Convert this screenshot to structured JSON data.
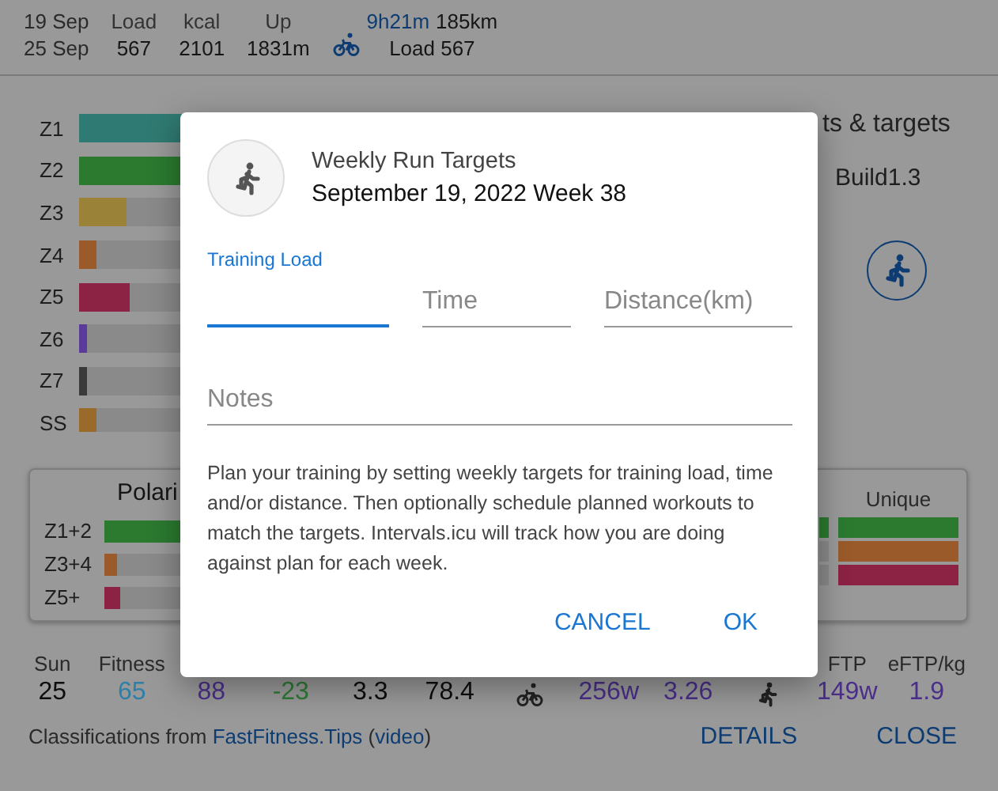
{
  "header": {
    "date_range": [
      "19 Sep",
      "25 Sep"
    ],
    "stats": [
      {
        "label": "Load",
        "value": "567"
      },
      {
        "label": "kcal",
        "value": "2101"
      },
      {
        "label": "Up",
        "value": "1831m"
      }
    ],
    "activity": {
      "kind": "bike",
      "time": "9h21m",
      "distance": "185km",
      "load": "Load 567"
    }
  },
  "zones": [
    {
      "label": "Z1",
      "level": 0.57,
      "color": "#2f7a72"
    },
    {
      "label": "Z2",
      "level": 0.5,
      "color": "#2b7a30"
    },
    {
      "label": "Z3",
      "level": 0.08,
      "color": "#9a8238"
    },
    {
      "label": "Z4",
      "level": 0.03,
      "color": "#9a5a2a"
    },
    {
      "label": "Z5",
      "level": 0.085,
      "color": "#8c2244"
    },
    {
      "label": "Z6",
      "level": 0.012,
      "color": "#5a3a9a"
    },
    {
      "label": "Z7",
      "level": 0.012,
      "color": "#3a3a3a"
    },
    {
      "label": "SS",
      "level": 0.03,
      "color": "#9a6a2a"
    }
  ],
  "side_panel": {
    "heading": "ts & targets",
    "plan": "Build1.3",
    "sport_button": {
      "kind": "run"
    }
  },
  "polarization": {
    "title": "Polari",
    "rows": [
      {
        "label": "Z1+2",
        "level": 0.6,
        "color": "#2b7a30"
      },
      {
        "label": "Z3+4",
        "level": 0.025,
        "color": "#9a5a2a"
      },
      {
        "label": "Z5+",
        "level": 0.03,
        "color": "#8c2244"
      }
    ],
    "columns": [
      {
        "bars": [
          {
            "filled": true,
            "color": "#2b7a30"
          },
          {
            "filled": false
          },
          {
            "filled": false
          }
        ]
      },
      {
        "title": "Unique",
        "bars": [
          {
            "level": 1,
            "color": "#2b7a30"
          },
          {
            "level": 1,
            "color": "#9a5a2a"
          },
          {
            "level": 1,
            "color": "#8c2244"
          }
        ]
      }
    ]
  },
  "stats": [
    {
      "kind": "stat",
      "label": "Sun",
      "value": "25"
    },
    {
      "kind": "stat",
      "label": "Fitness",
      "value": "65",
      "color": "#2d7fa8"
    },
    {
      "kind": "stat",
      "value": "88",
      "color": "#4a2e8a"
    },
    {
      "kind": "stat",
      "value": "-23",
      "color": "#2e7a35"
    },
    {
      "kind": "stat",
      "value": "3.3"
    },
    {
      "kind": "stat",
      "value": "78.4"
    },
    {
      "kind": "bike"
    },
    {
      "kind": "stat",
      "value": "256w",
      "color": "#4a2e8a"
    },
    {
      "kind": "stat",
      "value": "3.26",
      "color": "#4a2e8a"
    },
    {
      "kind": "run"
    },
    {
      "kind": "stat",
      "label": "FTP",
      "value": "149w",
      "color": "#4a2e8a"
    },
    {
      "kind": "stat",
      "label": "eFTP/kg",
      "value": "1.9",
      "color": "#4a2e8a"
    }
  ],
  "footer": {
    "credit": [
      {
        "text": "Classifications from "
      },
      {
        "text": "FastFitness.Tips",
        "link": true
      },
      {
        "text": " ("
      },
      {
        "text": "video",
        "link": true
      },
      {
        "text": ")"
      }
    ],
    "buttons": [
      "DETAILS",
      "CLOSE"
    ]
  },
  "dialog": {
    "title": "Weekly Run Targets",
    "subtitle": "September 19, 2022 Week 38",
    "fields": [
      {
        "label": "Training Load",
        "focused": true
      },
      {
        "placeholder": "Time",
        "focused": false
      },
      {
        "placeholder": "Distance(km)",
        "focused": false
      }
    ],
    "notes": {
      "placeholder": "Notes"
    },
    "help": "Plan your training by setting weekly targets for training load, time and/or distance. Then optionally schedule planned workouts to match the targets. Intervals.icu will track how you are doing against plan for each week.",
    "buttons": [
      "CANCEL",
      "OK"
    ]
  }
}
